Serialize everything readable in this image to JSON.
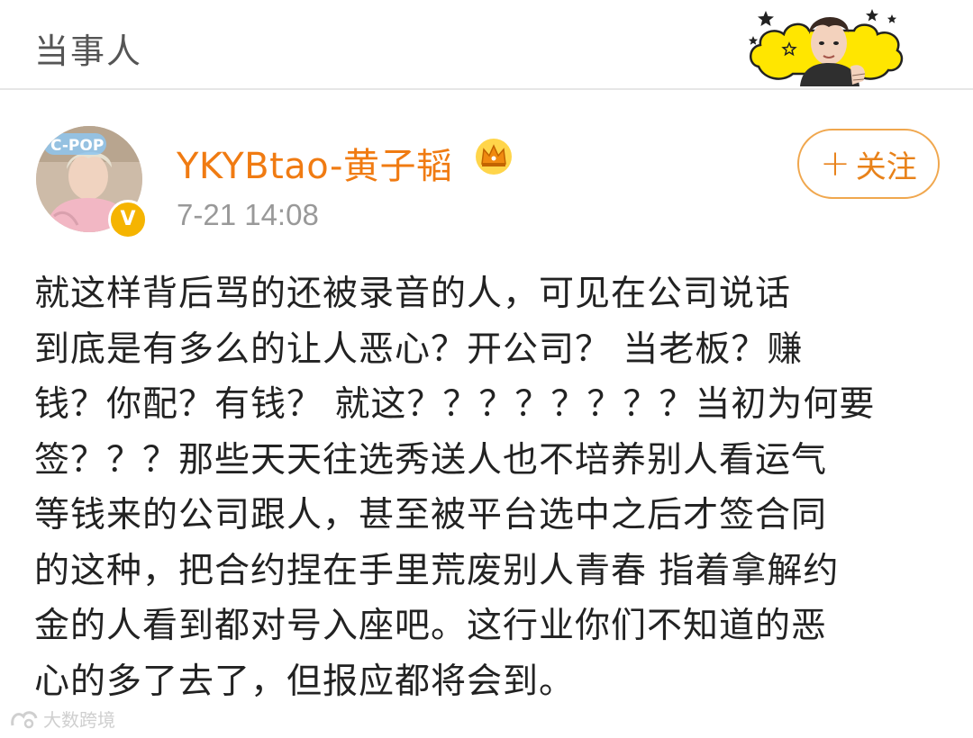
{
  "header": {
    "title": "当事人"
  },
  "post": {
    "username": "YKYBtao-黄子韬",
    "verified_badge": "V",
    "timestamp": "7-21 14:08",
    "follow_button": {
      "plus": "+",
      "label": "关注"
    },
    "text_lines": [
      "就这样背后骂的还被录音的人，可见在公司说话",
      "到底是有多么的让人恶心？开公司？ 当老板？赚",
      "钱？你配？有钱？ 就这？？？？？？？？当初为何要",
      "签？？？那些天天往选秀送人也不培养别人看运气",
      "等钱来的公司跟人，甚至被平台选中之后才签合同",
      "的这种，把合约捏在手里荒废别人青春 指着拿解约",
      "金的人看到都对号入座吧。这行业你们不知道的恶",
      "心的多了去了，但报应都将会到。"
    ]
  },
  "watermark": {
    "text": "大数跨境"
  },
  "icons": {
    "crown": "crown-icon",
    "avatar": "avatar-image",
    "header_decoration": "star-cloud-sticker"
  },
  "colors": {
    "username": "#f07b12",
    "follow_border": "#f0a74e",
    "follow_text": "#e8821a",
    "timestamp": "#999999",
    "badge": "#f5b400",
    "cloud": "#ffe600"
  }
}
